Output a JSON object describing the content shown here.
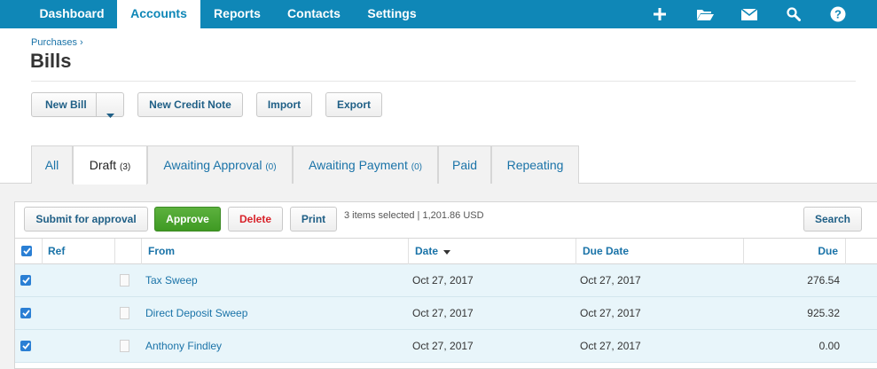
{
  "nav": {
    "items": [
      "Dashboard",
      "Accounts",
      "Reports",
      "Contacts",
      "Settings"
    ],
    "active": "Accounts",
    "icons": [
      "plus-icon",
      "folder-icon",
      "mail-icon",
      "search-icon",
      "help-icon"
    ]
  },
  "header": {
    "breadcrumb": "Purchases ›",
    "title": "Bills"
  },
  "actions": {
    "new_bill": "New Bill",
    "new_credit_note": "New Credit Note",
    "import": "Import",
    "export": "Export"
  },
  "tabs": [
    {
      "label": "All",
      "count": ""
    },
    {
      "label": "Draft",
      "count": "(3)"
    },
    {
      "label": "Awaiting Approval",
      "count": "(0)"
    },
    {
      "label": "Awaiting Payment",
      "count": "(0)"
    },
    {
      "label": "Paid",
      "count": ""
    },
    {
      "label": "Repeating",
      "count": ""
    }
  ],
  "toolbar": {
    "submit": "Submit for approval",
    "approve": "Approve",
    "delete": "Delete",
    "print": "Print",
    "selection_info": "3 items selected | 1,201.86 USD",
    "search": "Search"
  },
  "table": {
    "columns": {
      "ref": "Ref",
      "from": "From",
      "date": "Date",
      "due_date": "Due Date",
      "due": "Due"
    },
    "rows": [
      {
        "from": "Tax Sweep",
        "date": "Oct 27, 2017",
        "due_date": "Oct 27, 2017",
        "due": "276.54"
      },
      {
        "from": "Direct Deposit Sweep",
        "date": "Oct 27, 2017",
        "due_date": "Oct 27, 2017",
        "due": "925.32"
      },
      {
        "from": "Anthony Findley",
        "date": "Oct 27, 2017",
        "due_date": "Oct 27, 2017",
        "due": "0.00"
      }
    ]
  },
  "colors": {
    "brand": "#0f87b7",
    "approve": "#4aa52c",
    "delete": "#d8222a",
    "link": "#1a73a8"
  }
}
